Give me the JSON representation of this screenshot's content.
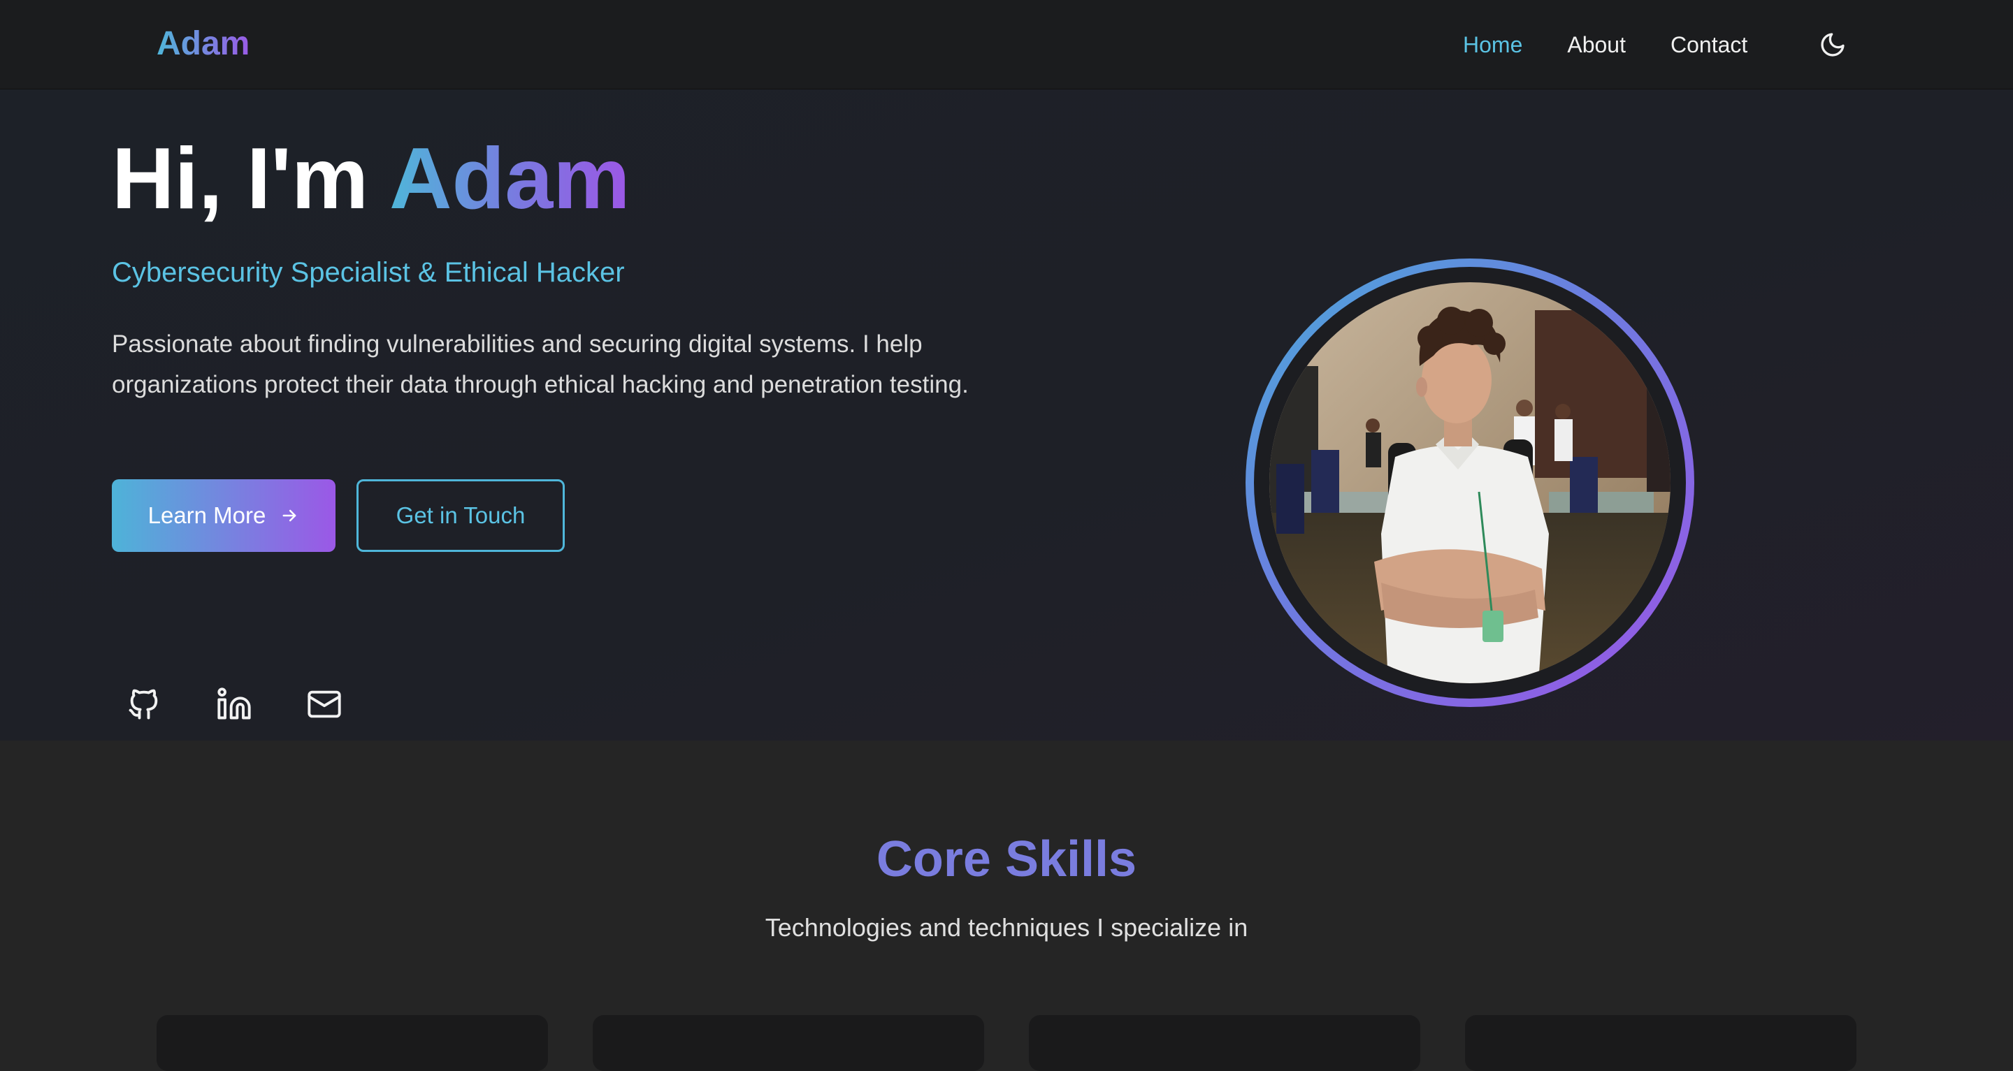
{
  "nav": {
    "brand": "Adam",
    "links": [
      "Home",
      "About",
      "Contact"
    ],
    "active": "Home"
  },
  "hero": {
    "greeting": "Hi, I'm ",
    "name": "Adam",
    "subtitle": "Cybersecurity Specialist & Ethical Hacker",
    "description": "Passionate about finding vulnerabilities and securing digital systems. I help organizations protect their data through ethical hacking and penetration testing.",
    "primary_button": "Learn More",
    "secondary_button": "Get in Touch",
    "socials": [
      "github-icon",
      "linkedin-icon",
      "mail-icon"
    ]
  },
  "skills": {
    "title": "Core Skills",
    "subtitle": "Technologies and techniques I specialize in"
  },
  "colors": {
    "accent_cyan": "#5bc3e4",
    "accent_purple": "#9a55e6",
    "background": "#252525",
    "navbar": "#1b1c1e"
  }
}
